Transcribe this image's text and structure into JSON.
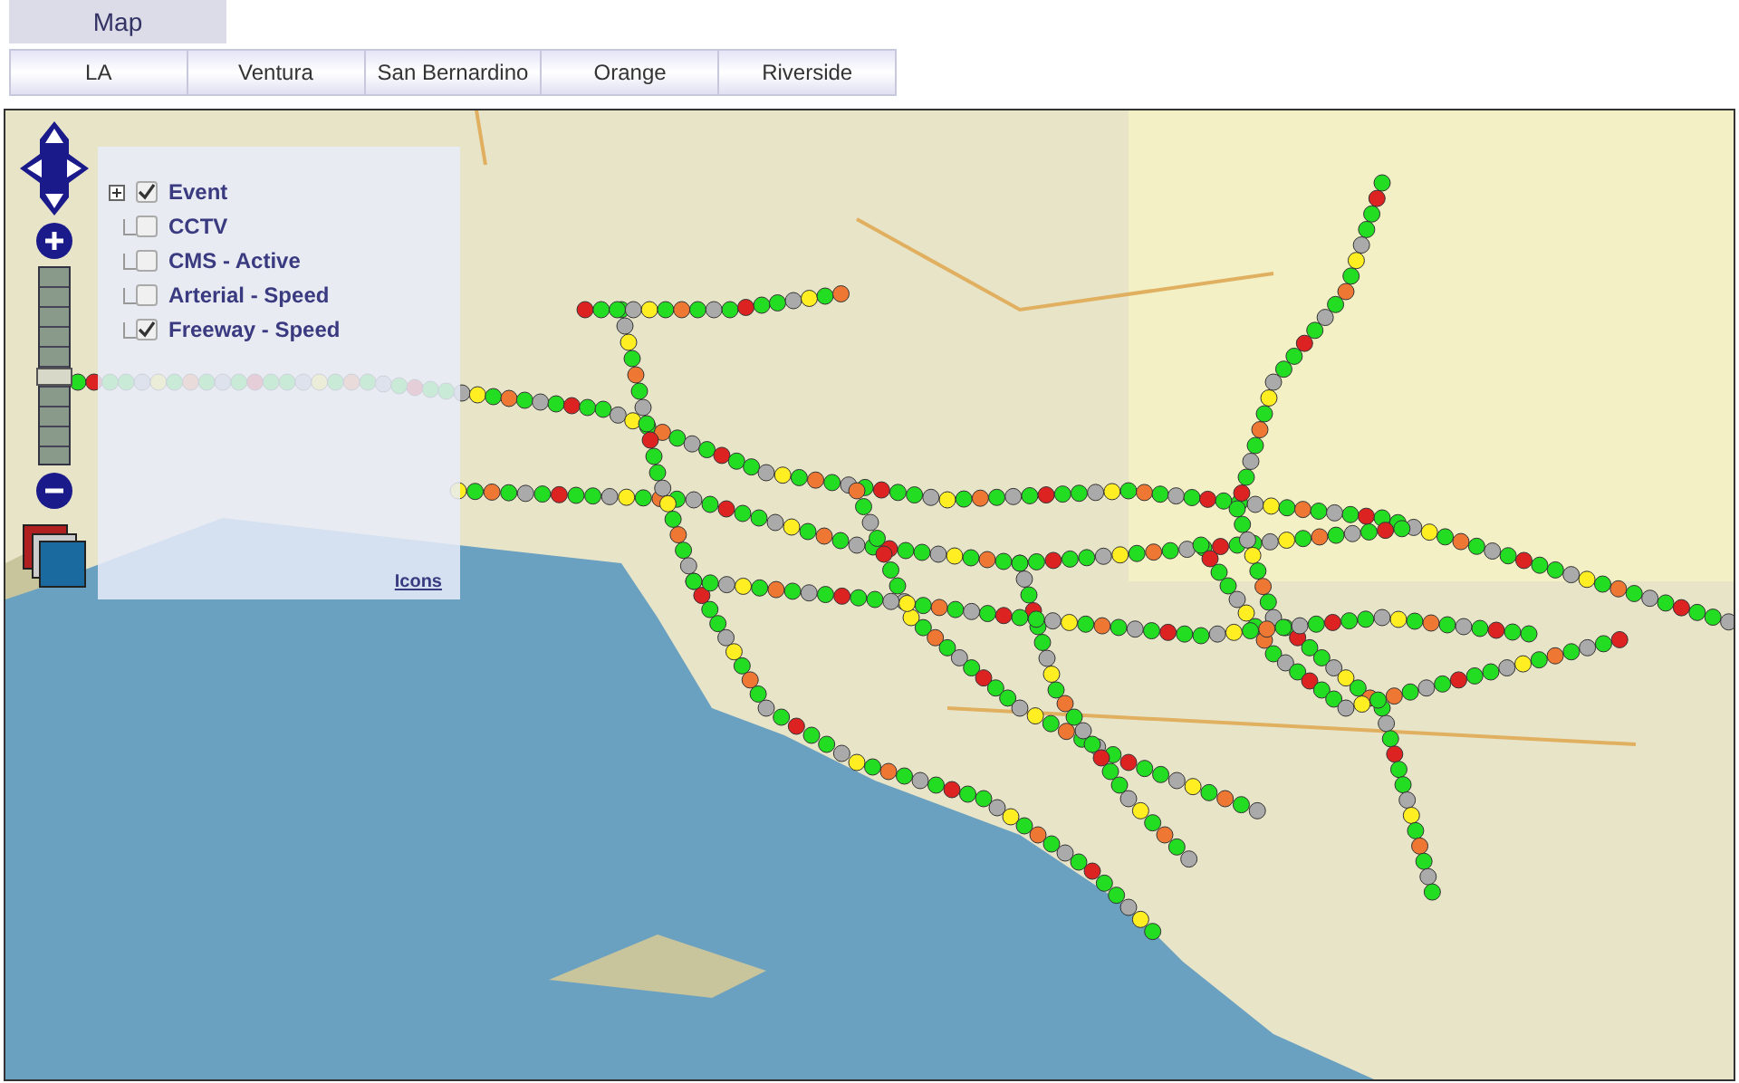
{
  "tabs": [
    {
      "label": "Map",
      "selected": true
    }
  ],
  "regions": [
    {
      "label": "LA"
    },
    {
      "label": "Ventura"
    },
    {
      "label": "San Bernardino"
    },
    {
      "label": "Orange"
    },
    {
      "label": "Riverside"
    }
  ],
  "zoom": {
    "level": 0.45
  },
  "layers": [
    {
      "label": "Event",
      "checked": true
    },
    {
      "label": "CCTV",
      "checked": false
    },
    {
      "label": "CMS - Active",
      "checked": false
    },
    {
      "label": "Arterial - Speed",
      "checked": false
    },
    {
      "label": "Freeway - Speed",
      "checked": true
    }
  ],
  "layers_expanded": false,
  "icons_link": "Icons"
}
